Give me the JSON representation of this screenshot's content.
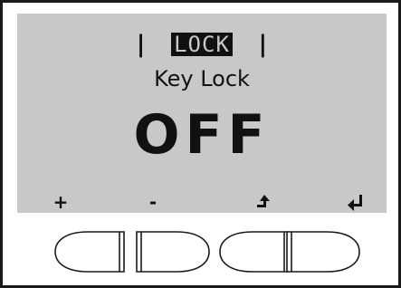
{
  "display": {
    "menu": {
      "divider_left": "|",
      "active_item": "LOCK",
      "divider_right": "|"
    },
    "parameter_label": "Key Lock",
    "parameter_value": "OFF"
  },
  "softkeys": {
    "key1": {
      "label": "+",
      "icon": "plus-icon"
    },
    "key2": {
      "label": "-",
      "icon": "minus-icon"
    },
    "key3": {
      "icon": "back-up-arrow-icon"
    },
    "key4": {
      "icon": "enter-return-icon"
    }
  },
  "colors": {
    "lcd_background": "#c8c8c8",
    "lcd_text": "#111111",
    "frame": "#1a1a1a"
  }
}
